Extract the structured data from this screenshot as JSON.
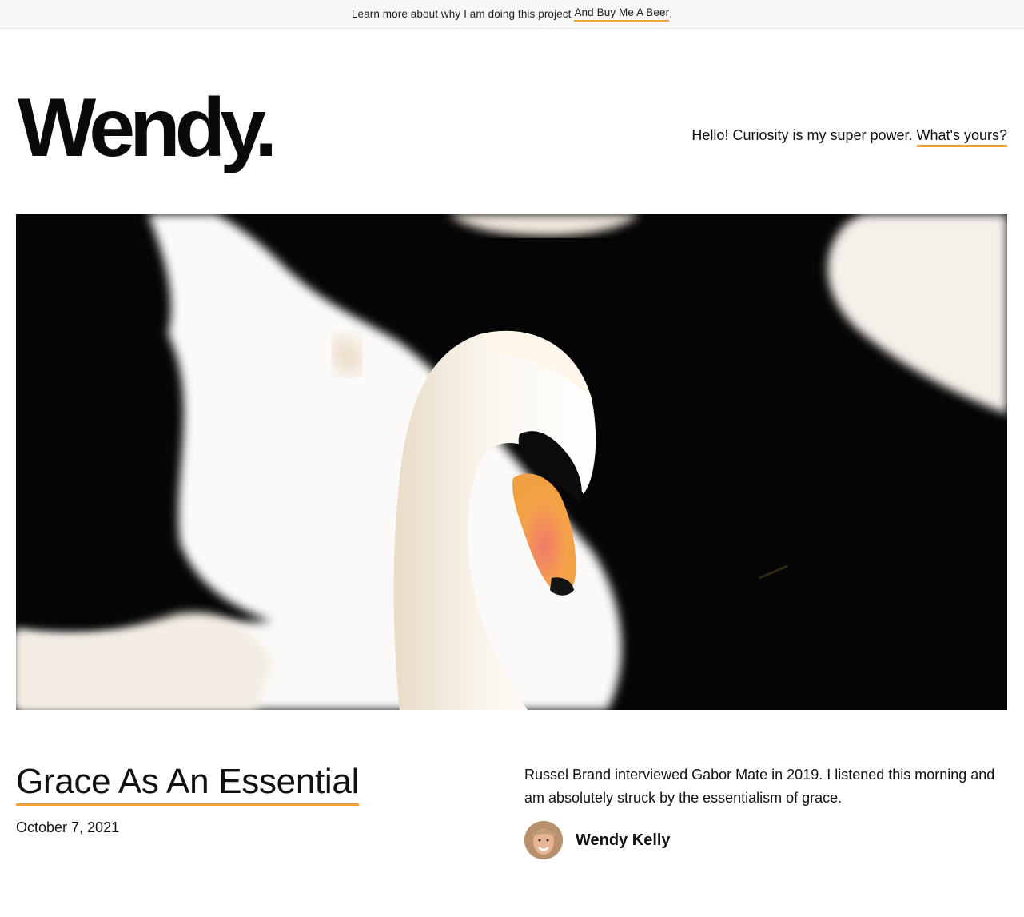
{
  "announcement": {
    "text": "Learn more about why I am doing this project",
    "link_label": "And Buy Me A Beer",
    "suffix": "."
  },
  "site": {
    "logo": "Wendy.",
    "tagline": "Hello! Curiosity is my super power.",
    "tagline_link": "What's yours?"
  },
  "hero": {
    "icon": "swan-photo"
  },
  "post": {
    "title": "Grace As An Essential",
    "date": "October 7, 2021",
    "excerpt": "Russel Brand interviewed Gabor Mate in 2019. I listened this morning and am absolutely struck by the essentialism of grace.",
    "author": "Wendy Kelly"
  },
  "colors": {
    "accent": "#f0a236",
    "text": "#111111",
    "hero_background": "#050505"
  }
}
